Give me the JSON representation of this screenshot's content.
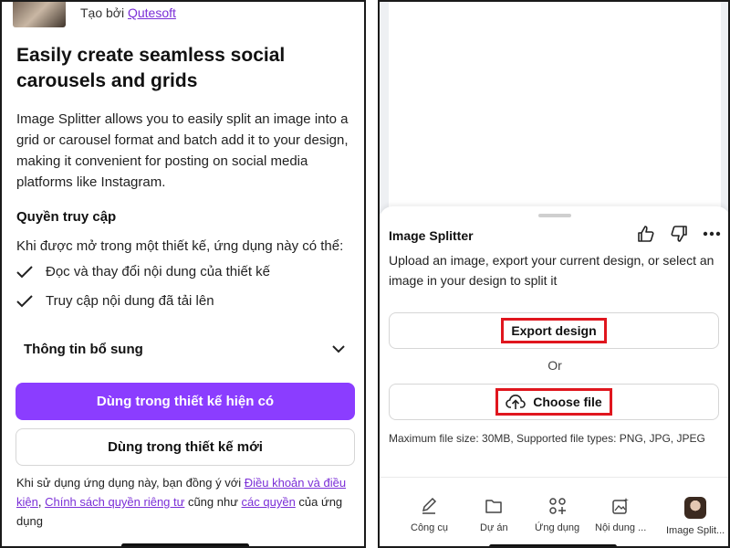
{
  "left": {
    "creator_prefix": "Tạo bởi",
    "creator_link": "Qutesoft",
    "headline": "Easily create seamless social carousels and grids",
    "description": "Image Splitter allows you to easily split an image into a grid or carousel format and batch add it to your design, making it convenient for posting on social media platforms like Instagram.",
    "access_title": "Quyền truy cập",
    "access_intro": "Khi được mở trong một thiết kế, ứng dụng này có thể:",
    "permissions": [
      "Đọc và thay đổi nội dung của thiết kế",
      "Truy cập nội dung đã tải lên"
    ],
    "more_info_label": "Thông tin bổ sung",
    "use_current_button": "Dùng trong thiết kế hiện có",
    "use_new_button": "Dùng trong thiết kế mới",
    "legal_prefix": "Khi sử dụng ứng dụng này, bạn đồng ý với ",
    "legal_terms": "Điều khoản và điều kiện",
    "legal_sep": ", ",
    "legal_privacy": "Chính sách quyền riêng tư",
    "legal_mid": " cũng như ",
    "legal_copyright": "các quyền",
    "legal_suffix": " của ứng dụng"
  },
  "right": {
    "app_title": "Image Splitter",
    "description": "Upload an image, export your current design, or select an image in your design to split it",
    "export_button": "Export design",
    "or_label": "Or",
    "choose_button": "Choose file",
    "limits": "Maximum file size: 30MB, Supported file types: PNG, JPG, JPEG",
    "nav": [
      "Công cụ",
      "Dự án",
      "Ứng dụng",
      "Nội dung ...",
      "Image Split..."
    ],
    "nav_edge_fragment": " "
  },
  "colors": {
    "accent": "#8b3dff",
    "link": "#7b2fd7",
    "highlight": "#e0161e"
  },
  "icons": [
    "check-icon",
    "chevron-down-icon",
    "thumbs-up-icon",
    "thumbs-down-icon",
    "more-icon",
    "upload-cloud-icon",
    "pen-icon",
    "folder-icon",
    "apps-icon",
    "image-magic-icon"
  ]
}
